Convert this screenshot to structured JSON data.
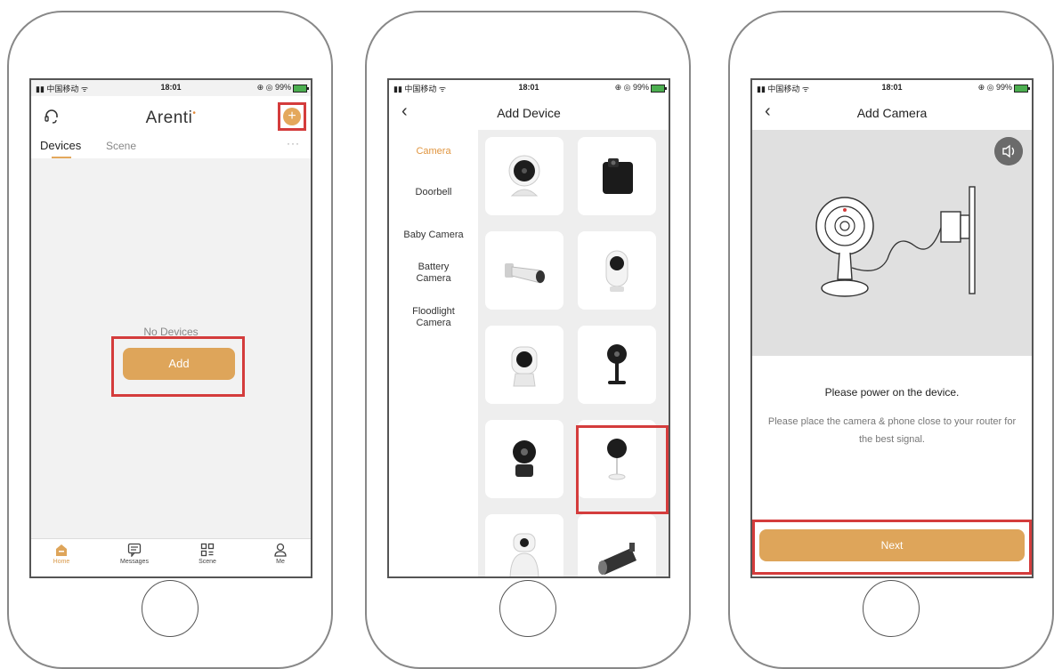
{
  "status_bar": {
    "carrier": "▮▮ 中国移动 ᯤ",
    "time": "18:01",
    "battery": "⊕ ◎ 99%"
  },
  "screen1": {
    "app_title": "Arenti",
    "tabs": [
      "Devices",
      "Scene"
    ],
    "more": "···",
    "empty_text": "No Devices",
    "add_label": "Add",
    "tabbar": [
      "Home",
      "Messages",
      "Scene",
      "Me"
    ]
  },
  "screen2": {
    "back": "‹",
    "title": "Add Device",
    "categories": [
      "Camera",
      "Doorbell",
      "Baby Camera",
      "Battery Camera",
      "Floodlight Camera"
    ]
  },
  "screen3": {
    "back": "‹",
    "title": "Add Camera",
    "instruction": "Please power on the device.",
    "hint": "Please place the camera & phone close to your router for the best signal.",
    "next_label": "Next"
  },
  "colors": {
    "accent": "#dea55a",
    "highlight": "#d43c3c"
  }
}
